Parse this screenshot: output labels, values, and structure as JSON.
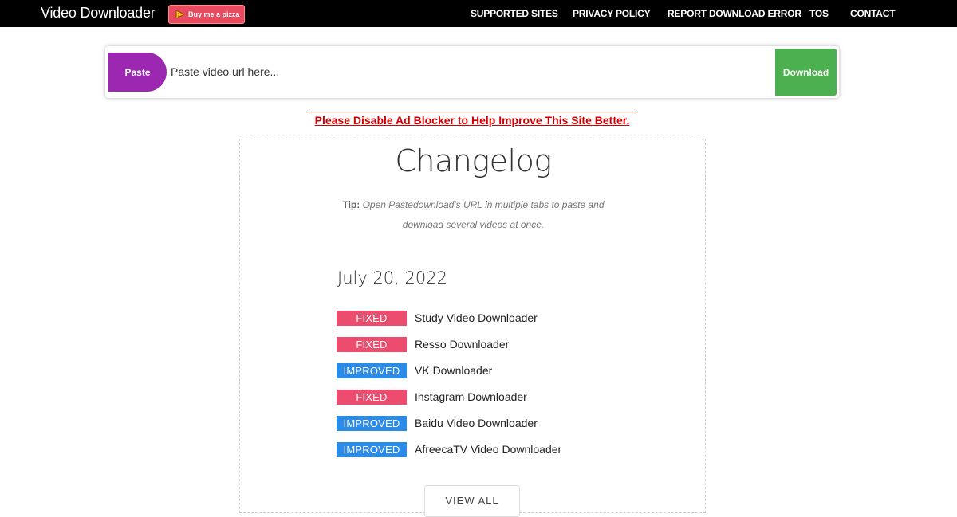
{
  "navbar": {
    "brand": "Video Downloader",
    "donate_label": "Buy me a pizza",
    "links": [
      {
        "label": "SUPPORTED SITES"
      },
      {
        "label": "PRIVACY POLICY"
      },
      {
        "label": "REPORT DOWNLOAD ERROR"
      },
      {
        "label": "TOS"
      },
      {
        "label": "CONTACT"
      }
    ]
  },
  "paste_bar": {
    "paste_label": "Paste",
    "input_placeholder": "Paste video url here...",
    "input_value": "",
    "download_label": "Download"
  },
  "notice": {
    "adblock_text": "Please Disable Ad Blocker to Help Improve This Site Better."
  },
  "changelog": {
    "title": "Changelog",
    "tip_label": "Tip:",
    "tip_text": "Open Pastedownload's URL in multiple tabs to paste and download several videos at once.",
    "date": "July 20, 2022",
    "entries": [
      {
        "status": "FIXED",
        "text": "Study Video Downloader"
      },
      {
        "status": "FIXED",
        "text": "Resso Downloader"
      },
      {
        "status": "IMPROVED",
        "text": "VK Downloader"
      },
      {
        "status": "FIXED",
        "text": "Instagram Downloader"
      },
      {
        "status": "IMPROVED",
        "text": "Baidu Video Downloader"
      },
      {
        "status": "IMPROVED",
        "text": "AfreecaTV Video Downloader"
      }
    ],
    "view_all_label": "VIEW ALL"
  },
  "colors": {
    "navbar_bg": "#000000",
    "paste_purple": "#9c27b0",
    "download_green": "#4caf50",
    "fixed_badge": "#ec4d6e",
    "improved_badge": "#2b8be8",
    "notice_red": "#d00000",
    "donate_red": "#e84a5f"
  },
  "icons": {
    "donate": "pizza-icon"
  }
}
